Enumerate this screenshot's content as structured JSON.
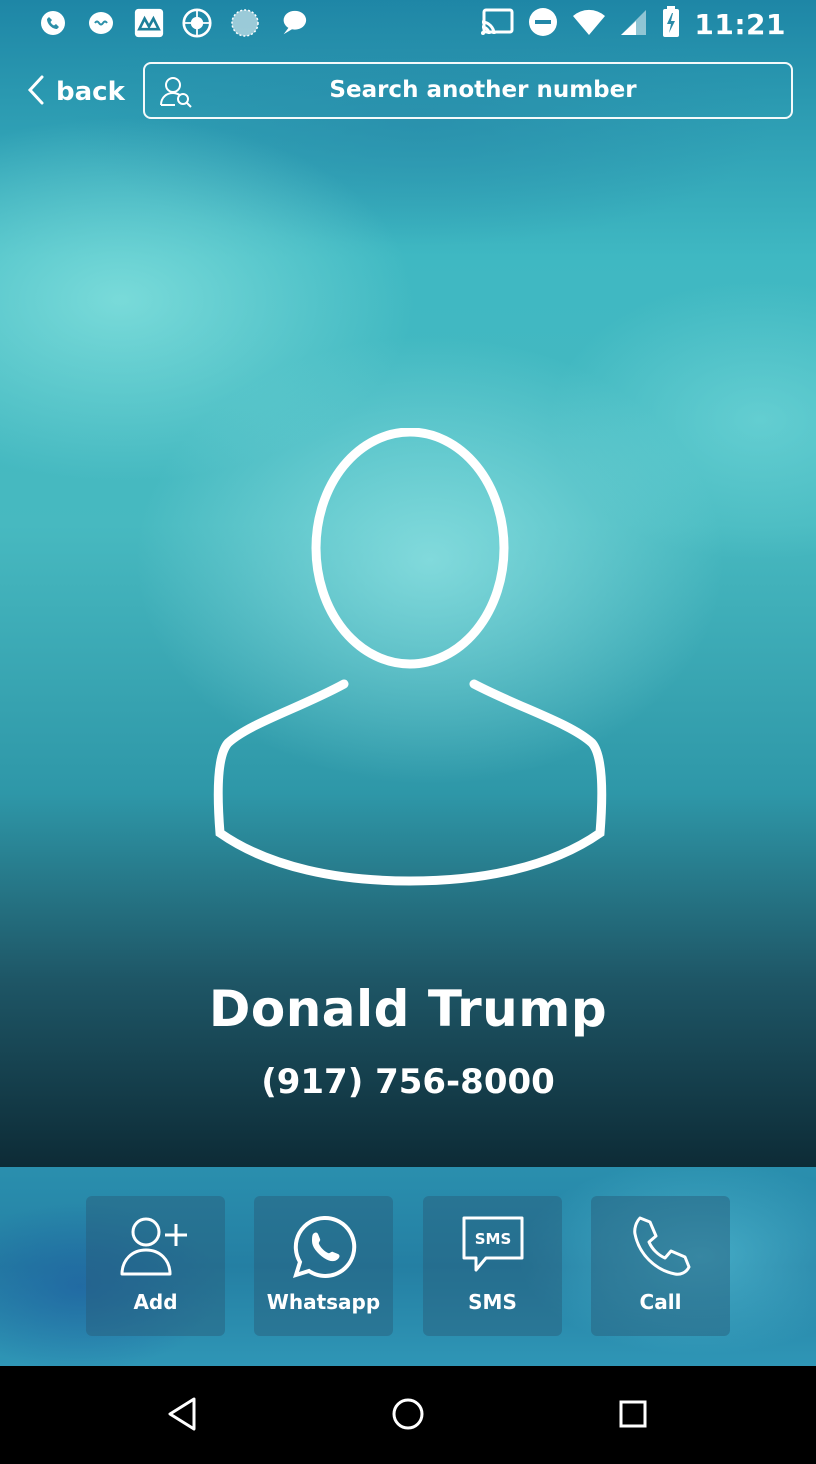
{
  "status_bar": {
    "time": "11:21",
    "left_icons": [
      "phone-notification-icon",
      "messaging-app-icon",
      "app-logo-icon",
      "globe-network-icon",
      "sphere-app-icon",
      "chat-bubble-icon"
    ],
    "right_icons": [
      "cast-icon",
      "do-not-disturb-icon",
      "wifi-icon",
      "cell-signal-icon",
      "battery-charging-icon"
    ]
  },
  "header": {
    "back_label": "back",
    "search_placeholder": "Search another number"
  },
  "contact": {
    "name": "Donald Trump",
    "phone": "(917) 756-8000"
  },
  "actions": [
    {
      "label": "Add",
      "icon": "add-contact-icon"
    },
    {
      "label": "Whatsapp",
      "icon": "whatsapp-icon"
    },
    {
      "label": "SMS",
      "icon": "sms-icon",
      "icon_text": "SMS"
    },
    {
      "label": "Call",
      "icon": "phone-icon"
    }
  ],
  "nav_bar": {
    "buttons": [
      "back-triangle-icon",
      "home-circle-icon",
      "recents-square-icon"
    ]
  },
  "colors": {
    "accent": "#3fb8c2",
    "action_bar": "#2a8fae",
    "nav_bar": "#000000"
  }
}
